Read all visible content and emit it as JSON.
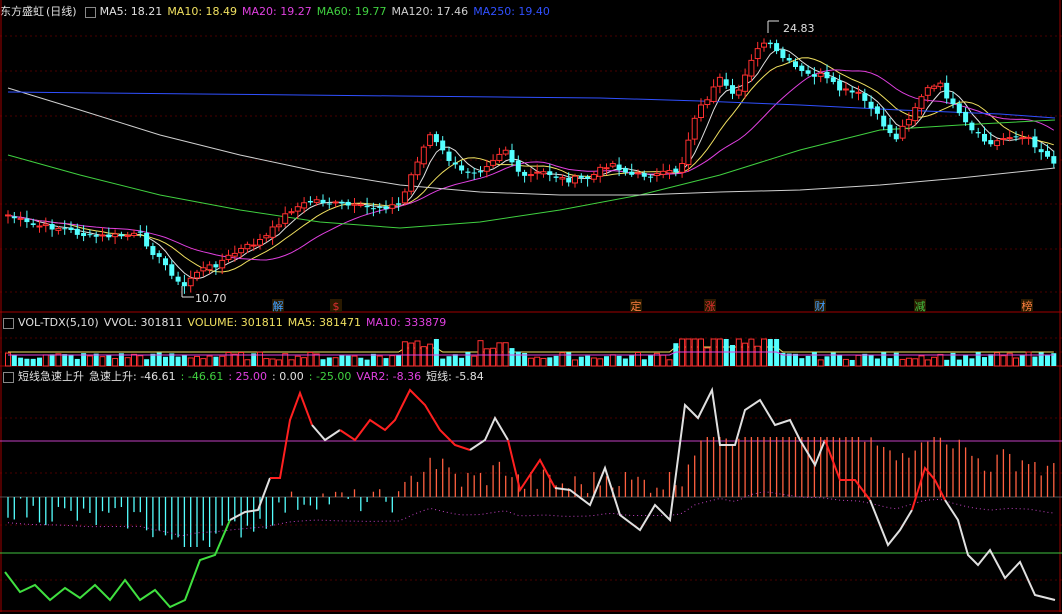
{
  "main_header": {
    "stock_name": "东方盛虹",
    "period": "(日线)",
    "ma_items": [
      {
        "label": "MA5: 18.21",
        "color": "#e0e0e0"
      },
      {
        "label": "MA10: 18.49",
        "color": "#f0e060"
      },
      {
        "label": "MA20: 19.27",
        "color": "#e040e0"
      },
      {
        "label": "MA60: 19.77",
        "color": "#40d040"
      },
      {
        "label": "MA120: 17.46",
        "color": "#d0d0d0"
      },
      {
        "label": "MA250: 19.40",
        "color": "#3050ff"
      }
    ]
  },
  "price_annotations": {
    "high": "24.83",
    "low": "10.70"
  },
  "event_markers": [
    {
      "label": "解",
      "color": "#40a0ff"
    },
    {
      "label": "$",
      "color": "#e03030"
    },
    {
      "label": "定",
      "color": "#ff8040"
    },
    {
      "label": "涨",
      "color": "#e03030"
    },
    {
      "label": "财",
      "color": "#40a0ff"
    },
    {
      "label": "减",
      "color": "#40c040"
    },
    {
      "label": "榜",
      "color": "#ff8040"
    }
  ],
  "volume_header": {
    "name": "VOL-TDX(5,10)",
    "items": [
      {
        "label": "VVOL: 301811",
        "color": "#e0e0e0"
      },
      {
        "label": "VOLUME: 301811",
        "color": "#f0e060"
      },
      {
        "label": "MA5: 381471",
        "color": "#f0e060"
      },
      {
        "label": "MA10: 333879",
        "color": "#e040e0"
      }
    ]
  },
  "indicator_header": {
    "name": "短线急速上升",
    "items": [
      {
        "label": "急速上升: -46.61",
        "color": "#e0e0e0"
      },
      {
        "label": ": -46.61",
        "color": "#40d040"
      },
      {
        "label": ": 25.00",
        "color": "#e040e0"
      },
      {
        "label": ": 0.00",
        "color": "#e0e0e0"
      },
      {
        "label": ": -25.00",
        "color": "#40d040"
      },
      {
        "label": "VAR2: -8.36",
        "color": "#e040e0"
      },
      {
        "label": "短线: -5.84",
        "color": "#e0e0e0"
      }
    ]
  },
  "colors": {
    "up": "#ff3030",
    "down": "#54ffff",
    "grid": "#5a0000",
    "border": "#a00000"
  }
}
